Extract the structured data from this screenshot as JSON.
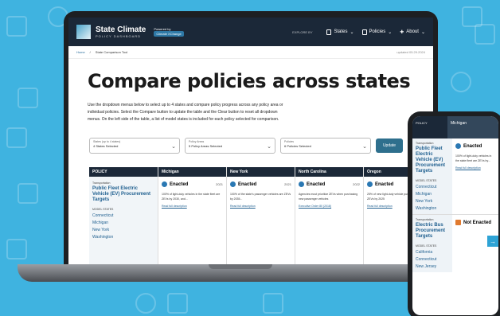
{
  "header": {
    "brand_title": "State Climate",
    "brand_subtitle": "POLICY DASHBOARD",
    "powered_label": "Powered by",
    "powered_badge": "Climate XChange",
    "nav_explore": "EXPLORE BY",
    "nav_states": "States",
    "nav_policies": "Policies",
    "nav_about": "About"
  },
  "breadcrumb": {
    "home": "Home",
    "current": "State Comparison Tool",
    "updated": "updated 05.29.2024"
  },
  "page_title": "Compare policies across states",
  "intro": "Use the dropdown menus below to select up to 4 states and compare policy progress across any policy area or individual policies. Select the Compare button to update the table and the Clear button to reset all dropdown menus. On the left side of the table, a list of model states is included for each policy selected for comparison.",
  "controls": {
    "states_label": "States (up to 4 states)",
    "states_value": "4 States Selected",
    "areas_label": "Policy Areas",
    "areas_value": "5 Policy Areas Selected",
    "policies_label": "Policies",
    "policies_value": "6 Policies Selected",
    "update_button": "Update"
  },
  "table": {
    "policy_header": "POLICY",
    "policy_area": "Transportation",
    "policy_title": "Public Fleet Electric Vehicle (EV) Procurement Targets",
    "model_states_label": "MODEL STATES",
    "model_states": [
      "Connecticut",
      "Michigan",
      "New York",
      "Washington"
    ],
    "states": [
      {
        "name": "Michigan",
        "status": "Enacted",
        "year": "2021",
        "desc": "100% of light-duty vehicles in the state fleet are ZEVs by 2030, and...",
        "link": "Read full description"
      },
      {
        "name": "New York",
        "status": "Enacted",
        "year": "2021",
        "desc": "100% of the state's passenger vehicles are ZEVs by 2035...",
        "link": "Read full description"
      },
      {
        "name": "North Carolina",
        "status": "Enacted",
        "year": "2022",
        "desc": "Agencies must prioritize ZEVs when purchasing new passenger vehicles",
        "link": "Executive Order 80 (2018)"
      },
      {
        "name": "Oregon",
        "status": "Enacted",
        "year": "2023",
        "desc": "25% of new light-duty vehicle purchases are ZEVs by 2025",
        "link": "Read full description"
      }
    ]
  },
  "phone": {
    "policy_header": "POLICY",
    "state_header": "Michigan",
    "policy_area": "Transportation",
    "policy_title": "Public Fleet Electric Vehicle (EV) Procurement Targets",
    "model_states_label": "MODEL STATES",
    "model_states": [
      "Connecticut",
      "Michigan",
      "New York",
      "Washington"
    ],
    "status": "Enacted",
    "desc": "100% of light-duty vehicles in the state fleet are ZEVs by...",
    "link": "Read full description",
    "policy2_area": "Transportation",
    "policy2_title": "Electric Bus Procurement Targets",
    "model2_label": "MODEL STATES",
    "model2_states": [
      "California",
      "Connecticut",
      "New Jersey"
    ],
    "status2": "Not Enacted"
  }
}
